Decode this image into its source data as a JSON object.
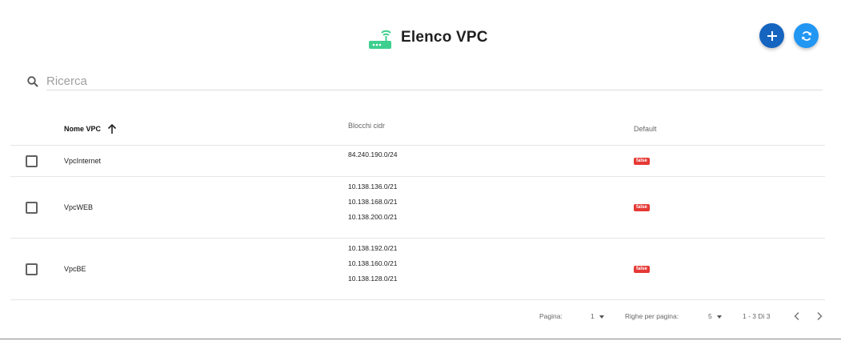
{
  "header": {
    "title": "Elenco VPC",
    "icon": "router-icon",
    "add_icon": "plus-icon",
    "refresh_icon": "refresh-icon",
    "accent_color": "#1565c0",
    "refresh_color": "#2196f3",
    "icon_color": "#3ecf8e"
  },
  "search": {
    "placeholder": "Ricerca",
    "value": ""
  },
  "table": {
    "columns": [
      "Nome VPC",
      "Blocchi cidr",
      "Default"
    ],
    "sort_column": "Nome VPC",
    "sort_direction": "ascending",
    "rows": [
      {
        "name": "VpcInternet",
        "cidrs": [
          "84.240.190.0/24"
        ],
        "default": "false",
        "selected": false
      },
      {
        "name": "VpcWEB",
        "cidrs": [
          "10.138.136.0/21",
          "10.138.168.0/21",
          "10.138.200.0/21"
        ],
        "default": "false",
        "selected": false
      },
      {
        "name": "VpcBE",
        "cidrs": [
          "10.138.192.0/21",
          "10.138.160.0/21",
          "10.138.128.0/21"
        ],
        "default": "false",
        "selected": false
      }
    ],
    "badge_color": "#e53935"
  },
  "pagination": {
    "page_label": "Pagina:",
    "page_value": "1",
    "rows_label": "Righe per pagina:",
    "rows_value": "5",
    "range": "1 - 3 Di 3"
  }
}
